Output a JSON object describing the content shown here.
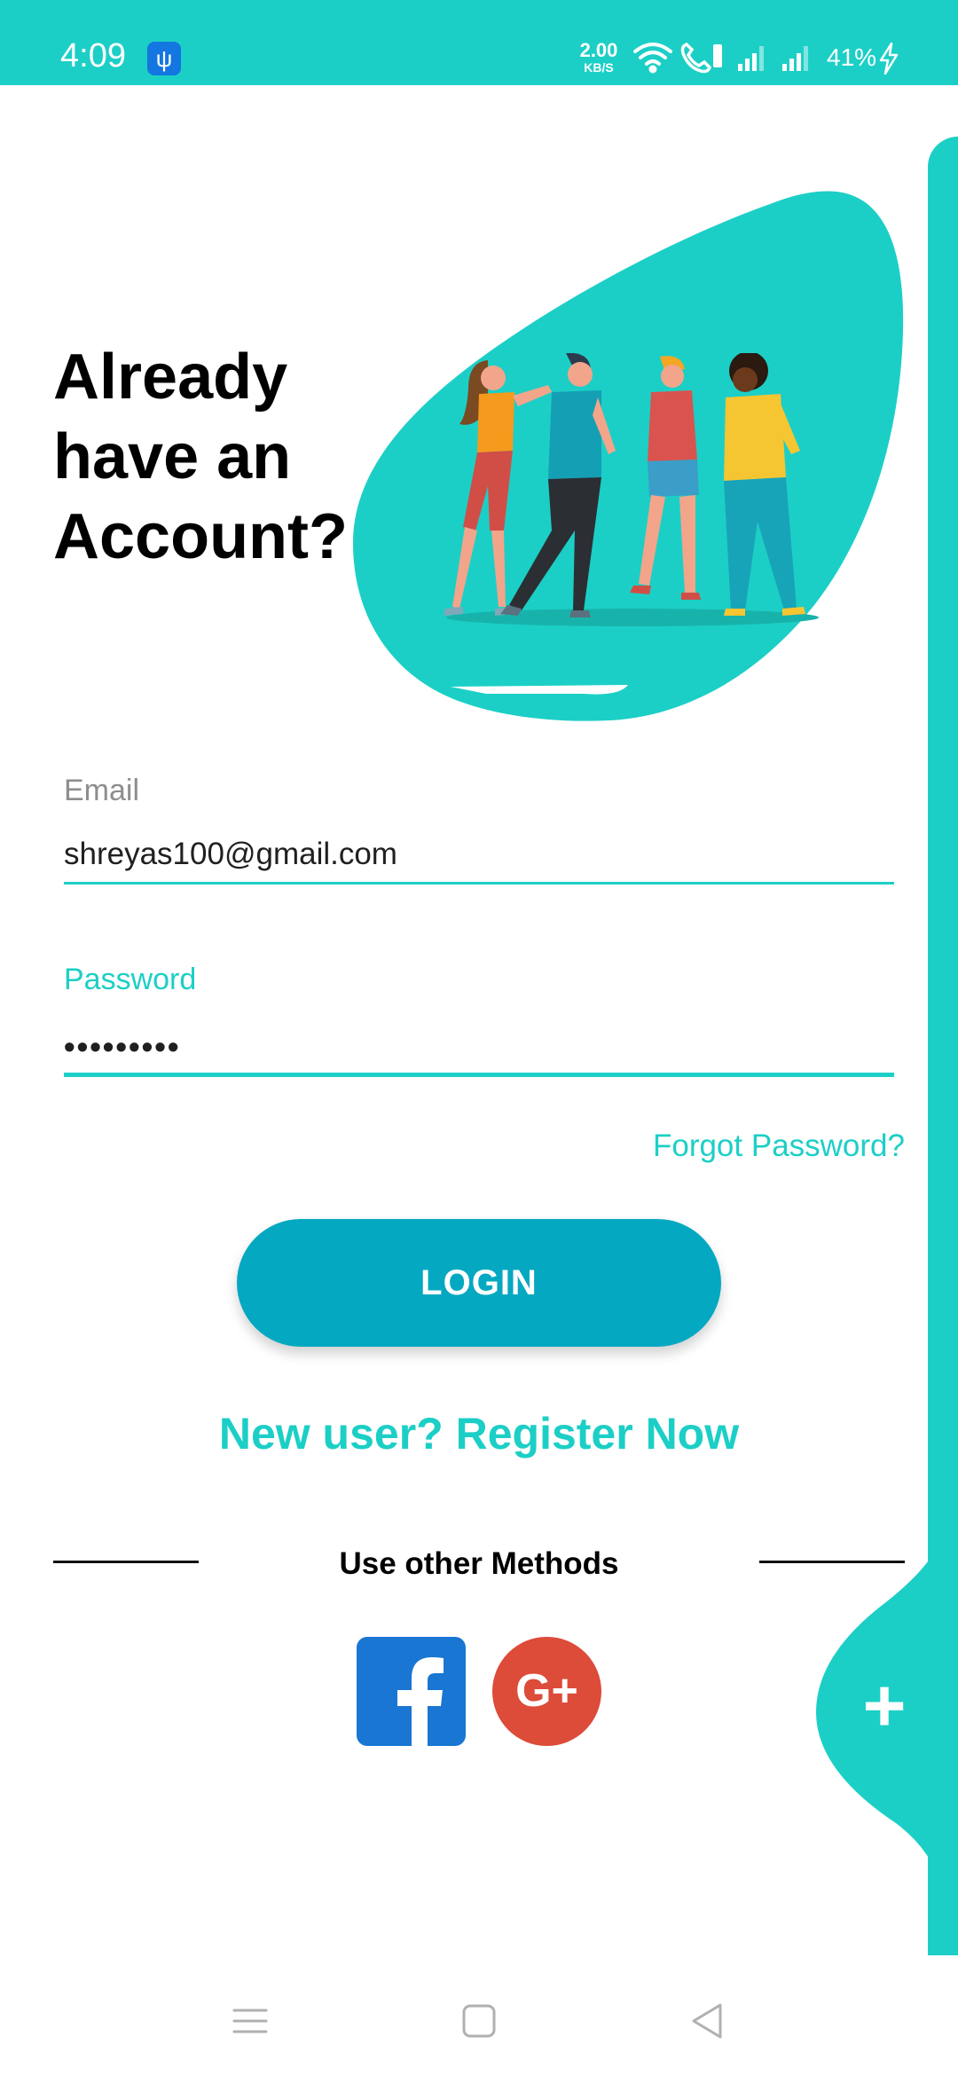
{
  "status_bar": {
    "time": "4:09",
    "usb_icon": "usb-icon",
    "net_speed_value": "2.00",
    "net_speed_unit": "KB/S",
    "battery": "41%",
    "color": "#1ccfc6"
  },
  "hero": {
    "title": "Already have an Account?",
    "blob_color": "#1ccfc6"
  },
  "form": {
    "email_label": "Email",
    "email_value": "shreyas100@gmail.com",
    "password_label": "Password",
    "password_value": "•••••••••",
    "forgot_label": "Forgot Password?",
    "login_label": "LOGIN",
    "register_label": "New user? Register Now",
    "accent_color": "#1ccfc6",
    "button_color": "#05a8c1"
  },
  "social": {
    "heading": "Use other Methods",
    "facebook_icon": "facebook-icon",
    "google_label": "G+",
    "facebook_color": "#1976d2",
    "google_color": "#dd4b39"
  },
  "fab": {
    "label": "+"
  },
  "nav_bar": {
    "menu_icon": "menu-icon",
    "home_icon": "home-icon",
    "back_icon": "back-icon"
  }
}
